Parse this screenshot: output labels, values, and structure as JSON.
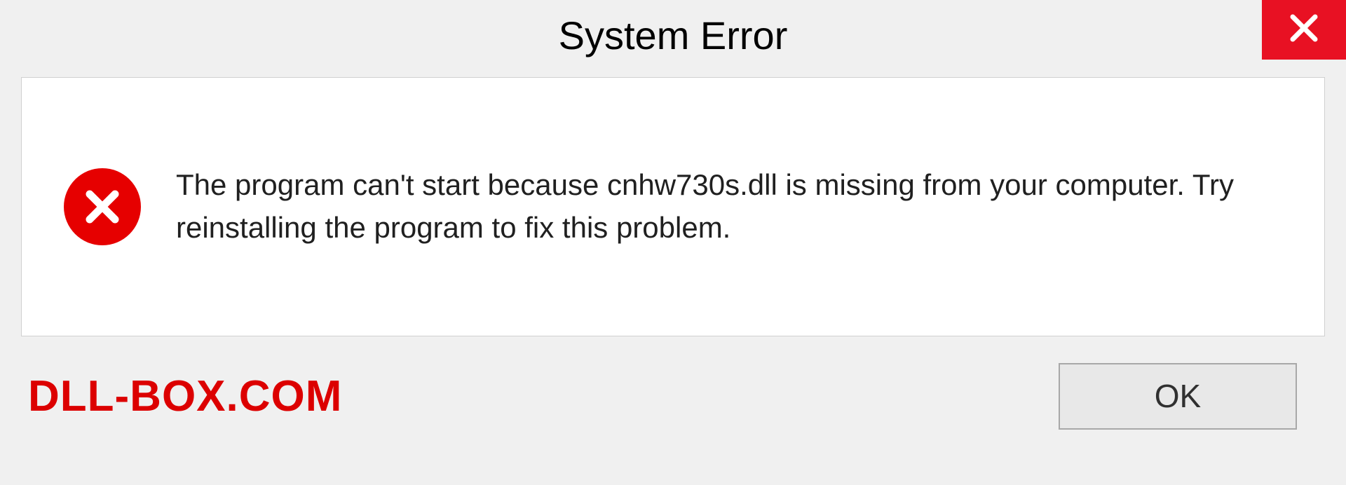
{
  "dialog": {
    "title": "System Error",
    "message": "The program can't start because cnhw730s.dll is missing from your computer. Try reinstalling the program to fix this problem.",
    "ok_label": "OK"
  },
  "watermark": {
    "text": "DLL-BOX.COM"
  },
  "colors": {
    "close_bg": "#e81123",
    "error_icon": "#e60000",
    "watermark": "#dc0000"
  }
}
